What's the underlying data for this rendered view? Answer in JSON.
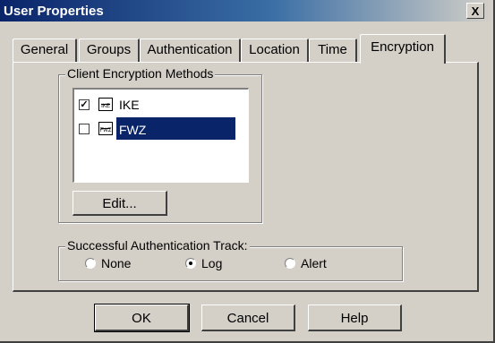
{
  "window": {
    "title": "User Properties",
    "close_label": "X"
  },
  "tabs": [
    {
      "label": "General",
      "active": false
    },
    {
      "label": "Groups",
      "active": false
    },
    {
      "label": "Authentication",
      "active": false
    },
    {
      "label": "Location",
      "active": false
    },
    {
      "label": "Time",
      "active": false
    },
    {
      "label": "Encryption",
      "active": true
    }
  ],
  "client_encryption": {
    "legend": "Client Encryption Methods",
    "items": [
      {
        "label": "IKE",
        "checked": true,
        "selected": false,
        "icon": "ike-icon",
        "icon_text": "IKE"
      },
      {
        "label": "FWZ",
        "checked": false,
        "selected": true,
        "icon": "fwz-icon",
        "icon_text": "FWZ"
      }
    ],
    "edit_label": "Edit..."
  },
  "auth_track": {
    "legend": "Successful Authentication Track:",
    "options": [
      {
        "label": "None",
        "selected": false
      },
      {
        "label": "Log",
        "selected": true
      },
      {
        "label": "Alert",
        "selected": false
      }
    ]
  },
  "footer": {
    "ok_label": "OK",
    "cancel_label": "Cancel",
    "help_label": "Help"
  },
  "colors": {
    "dialog_bg": "#d4d0c8",
    "titlebar": "#0a246a",
    "selection": "#0a246a"
  }
}
